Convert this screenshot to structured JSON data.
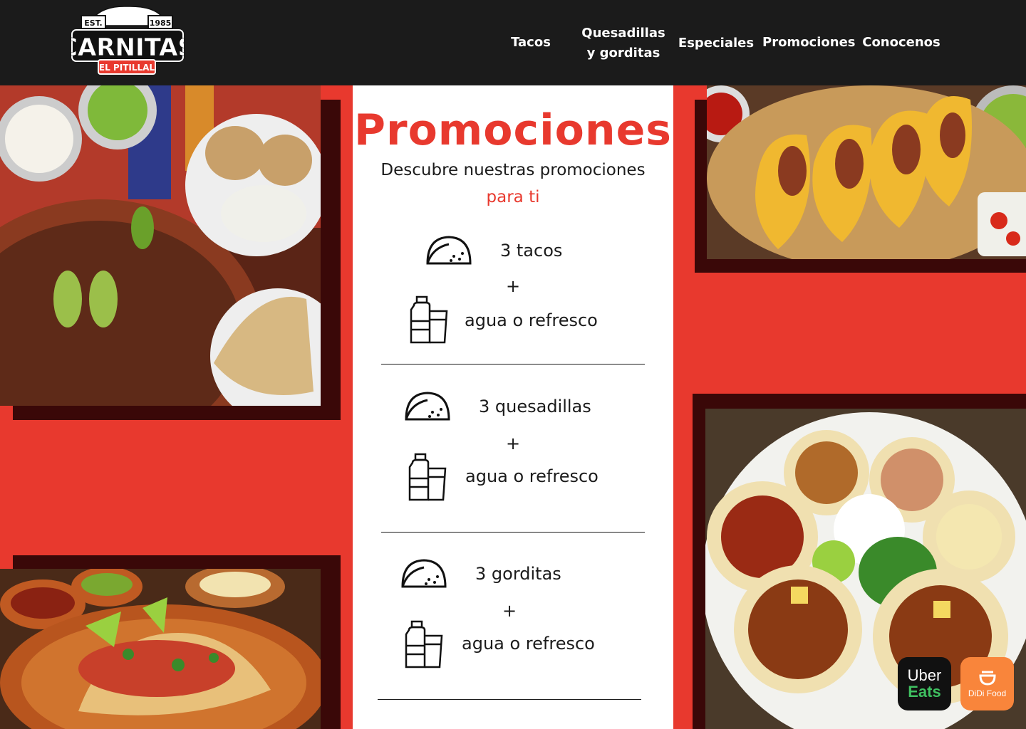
{
  "brand": {
    "est": "EST.",
    "year": "1985",
    "name": "CARNITAS",
    "tagline": "EL PITILLAL"
  },
  "nav": {
    "tacos": "Tacos",
    "quesadillas_line1": "Quesadillas",
    "quesadillas_line2": "y gorditas",
    "especiales": "Especiales",
    "promociones": "Promociones",
    "conocenos": "Conocenos"
  },
  "promo": {
    "title": "Promociones",
    "subtitle": "Descubre nuestras promociones",
    "subtitle_highlight": "para ti",
    "items": [
      {
        "food": "3 tacos",
        "plus": "+",
        "drink": "agua o refresco"
      },
      {
        "food": "3 quesadillas",
        "plus": "+",
        "drink": "agua o refresco"
      },
      {
        "food": "3 gorditas",
        "plus": "+",
        "drink": "agua o refresco"
      }
    ]
  },
  "apps": {
    "uber_line1": "Uber",
    "uber_line2": "Eats",
    "didi_label": "DiDi Food"
  },
  "colors": {
    "accent": "#e8392e",
    "header": "#1b1b1b",
    "uber_green": "#3fc060",
    "didi_orange": "#f9853b"
  }
}
